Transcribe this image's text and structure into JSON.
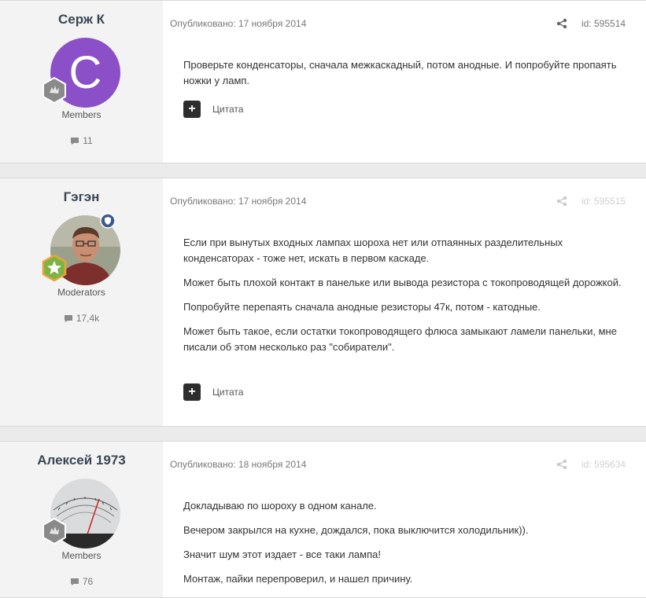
{
  "posts": [
    {
      "author": "Серж К",
      "avatar_letter": "C",
      "group": "Members",
      "post_count": "11",
      "published": "Опубликовано: 17 ноября 2014",
      "id": "id: 595514",
      "paragraphs": [
        "Проверьте конденсаторы, сначала межкаскадный, потом анодные. И попробуйте пропаять ножки у ламп."
      ],
      "plus_label": "+",
      "quote_label": "Цитата"
    },
    {
      "author": "Гэгэн",
      "group": "Moderators",
      "post_count": "17,4k",
      "published": "Опубликовано: 17 ноября 2014",
      "id": "id: 595515",
      "paragraphs": [
        "Если при вынутых входных лампах шороха нет или отпаянных разделительных конденсаторах - тоже нет, искать в первом каскаде.",
        "Может быть плохой контакт в панельке или вывода резистора с токопроводящей дорожкой.",
        "Попробуйте перепаять сначала анодные резисторы 47к, потом - катодные.",
        "Может быть такое, если остатки токопроводящего флюса замыкают ламели панельки, мне писали об этом несколько раз \"собиратели\"."
      ],
      "plus_label": "+",
      "quote_label": "Цитата"
    },
    {
      "author": "Алексей 1973",
      "group": "Members",
      "post_count": "76",
      "published": "Опубликовано: 18 ноября 2014",
      "id": "id: 595634",
      "paragraphs": [
        "Докладываю по шороху в одном канале.",
        "Вечером закрылся на кухне, дождался, пока выключится холодильник)).",
        "Значит шум этот издает - все таки лампа!",
        "Монтаж, пайки перепроверил, и нашел причину."
      ]
    }
  ],
  "colors": {
    "avatar_purple": "#8b4fc7",
    "author_name": "#3a4654",
    "author_bg": "#f3f3f3"
  }
}
